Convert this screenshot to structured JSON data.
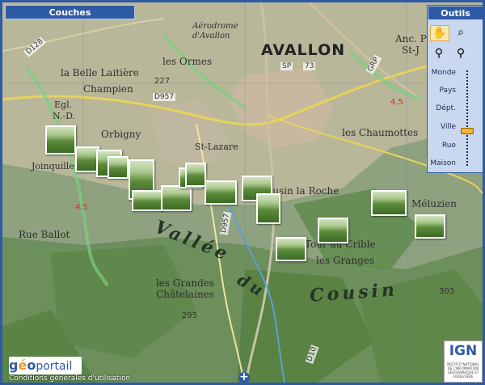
{
  "layers_panel": {
    "title": "Couches"
  },
  "tools_panel": {
    "title": "Outils",
    "zoom_levels": [
      "Monde",
      "Pays",
      "Dépt.",
      "Ville",
      "Rue",
      "Maison"
    ],
    "current_zoom": "Ville"
  },
  "map": {
    "places": [
      "Aérodrome d'Avallon",
      "AVALLON",
      "Anc. P",
      "St-J",
      "les Ormes",
      "la Belle Laitière",
      "Champien",
      "Orbigny",
      "Egl.",
      "N.-D.",
      "Joinquille",
      "St-Lazare",
      "les Chaumottes",
      "Cousin la Roche",
      "Méluzien",
      "Rue Ballot",
      "Tour au Crible",
      "les Granges",
      "les Grandes Châtelaines",
      "Vallée",
      "du",
      "Cousin"
    ],
    "road_labels": [
      "D128",
      "D957",
      "D957",
      "D10",
      "SP",
      "73",
      "GRP"
    ],
    "elevations": [
      "227",
      "303",
      "295",
      "4.5",
      "4.5"
    ]
  },
  "footer": {
    "portal_logo": "géoportail",
    "terms_link": "Conditions générales d'utilisation",
    "add_symbol": "+"
  },
  "ign_logo": {
    "brand": "IGN",
    "subtitle": "INSTITUT NATIONAL DE L'INFORMATION GÉOGRAPHIQUE ET FORESTIÈRE"
  }
}
